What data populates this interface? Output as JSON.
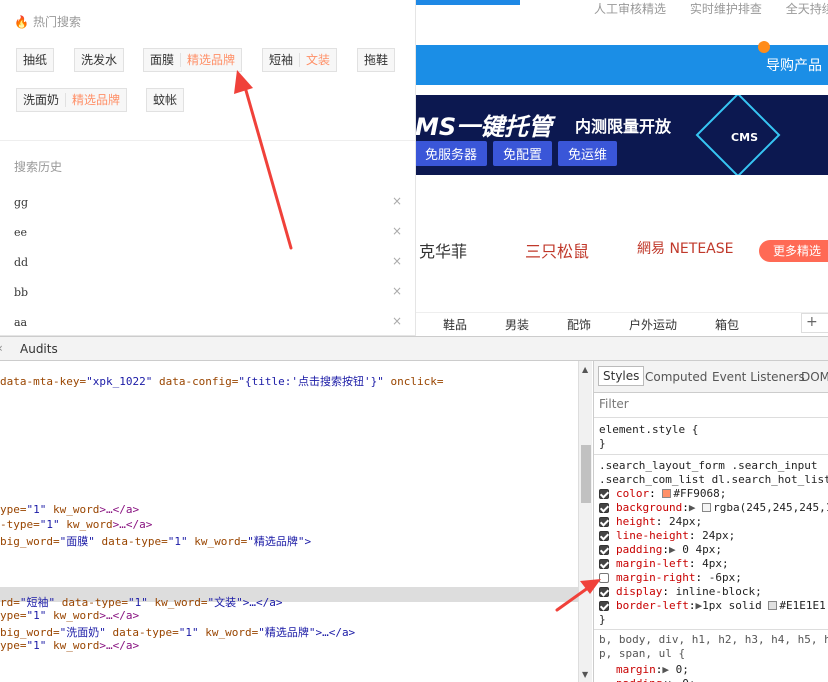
{
  "page_top_links": [
    "人工审核精选",
    "实时维护排查",
    "全天持续"
  ],
  "nav": {
    "shop_label": "导购产品"
  },
  "banner": {
    "title": "MS一键托管",
    "subtitle": "内测限量开放",
    "pills": [
      "免服务器",
      "免配置",
      "免运维"
    ],
    "logo_text": "CMS"
  },
  "brands": [
    "克华菲",
    "三只松鼠",
    "網易 NETEASE"
  ],
  "brands_more": "更多精选",
  "categories": [
    "鞋品",
    "男装",
    "配饰",
    "户外运动",
    "箱包"
  ],
  "plus": "+",
  "dropdown": {
    "hot_title": "热门搜索",
    "hot_tags": [
      {
        "word": "抽纸",
        "badge": ""
      },
      {
        "word": "洗发水",
        "badge": ""
      },
      {
        "word": "面膜",
        "badge": "精选品牌"
      },
      {
        "word": "短袖",
        "badge": "文装"
      },
      {
        "word": "拖鞋",
        "badge": ""
      },
      {
        "word": "洗面奶",
        "badge": "精选品牌"
      },
      {
        "word": "蚊帐",
        "badge": ""
      }
    ],
    "history_title": "搜索历史",
    "history": [
      "gg",
      "ee",
      "dd",
      "bb",
      "aa"
    ],
    "remove_glyph": "×"
  },
  "devtools": {
    "panel_tab": "Audits",
    "code_lines": [
      {
        "a": "data-mta-key=",
        "v": "\"xpk_1022\"",
        "a2": " data-config=",
        "v2": "\"{title:'点击搜索按钮'}\"",
        "a3": " onclick=",
        "v3": ""
      },
      {
        "a": "ype=",
        "v": "\"1\"",
        "a2": " kw_word",
        "v2": ">…</a>",
        "a3": "",
        "v3": ""
      },
      {
        "a": "-type=",
        "v": "\"1\"",
        "a2": " kw_word",
        "v2": ">…</a>",
        "a3": "",
        "v3": ""
      },
      {
        "a": "big_word=",
        "v": "\"面膜\"",
        "a2": " data-type=",
        "v2": "\"1\"",
        "a3": " kw_word=",
        "v3": "\"精选品牌\">"
      },
      {
        "a": "rd=",
        "v": "\"短袖\"",
        "a2": " data-type=",
        "v2": "\"1\"",
        "a3": " kw_word=",
        "v3": "\"文装\">…</a>"
      },
      {
        "a": "ype=",
        "v": "\"1\"",
        "a2": " kw_word",
        "v2": ">…</a>",
        "a3": "",
        "v3": ""
      },
      {
        "a": "big_word=",
        "v": "\"洗面奶\"",
        "a2": " data-type=",
        "v2": "\"1\"",
        "a3": " kw_word=",
        "v3": "\"精选品牌\">…</a>"
      },
      {
        "a": "ype=",
        "v": "\"1\"",
        "a2": " kw_word",
        "v2": ">…</a>",
        "a3": "",
        "v3": ""
      }
    ],
    "side_tabs": [
      "Styles",
      "Computed",
      "Event Listeners",
      "DOM"
    ],
    "filter_placeholder": "Filter",
    "element_style": [
      "element.style {",
      "}"
    ],
    "selector_lines": [
      ".search_layout_form .search_input",
      ".search_com_list dl.search_hot_list"
    ],
    "rules": [
      {
        "name": "color",
        "value": "#FF9068;",
        "checked": true,
        "swatch": "#FF9068",
        "tri": false
      },
      {
        "name": "background",
        "value": "rgba(245,245,245,1",
        "checked": true,
        "swatch": "#f5f5f5",
        "tri": true
      },
      {
        "name": "height",
        "value": "24px;",
        "checked": true,
        "swatch": "",
        "tri": false
      },
      {
        "name": "line-height",
        "value": "24px;",
        "checked": true,
        "swatch": "",
        "tri": false
      },
      {
        "name": "padding",
        "value": "0 4px;",
        "checked": true,
        "swatch": "",
        "tri": true
      },
      {
        "name": "margin-left",
        "value": "4px;",
        "checked": true,
        "swatch": "",
        "tri": false
      },
      {
        "name": "margin-right",
        "value": "-6px;",
        "checked": false,
        "swatch": "",
        "tri": false
      },
      {
        "name": "display",
        "value": "inline-block;",
        "checked": true,
        "swatch": "",
        "tri": false
      },
      {
        "name": "border-left",
        "value": "1px solid",
        "checked": true,
        "swatch": "#E1E1E1",
        "tri": true,
        "tail": "#E1E1E1"
      }
    ],
    "close_brace": "}",
    "reset_selector": [
      "b, body, div, h1, h2, h3, h4, h5, h",
      "p, span, ul {"
    ],
    "reset_rules": [
      {
        "name": "margin",
        "value": "0;"
      },
      {
        "name": "padding",
        "value": "0;"
      }
    ]
  },
  "colors": {
    "accent": "#FF9068",
    "nav_blue": "#1b8ee6",
    "arrow_red": "#f0413a"
  }
}
